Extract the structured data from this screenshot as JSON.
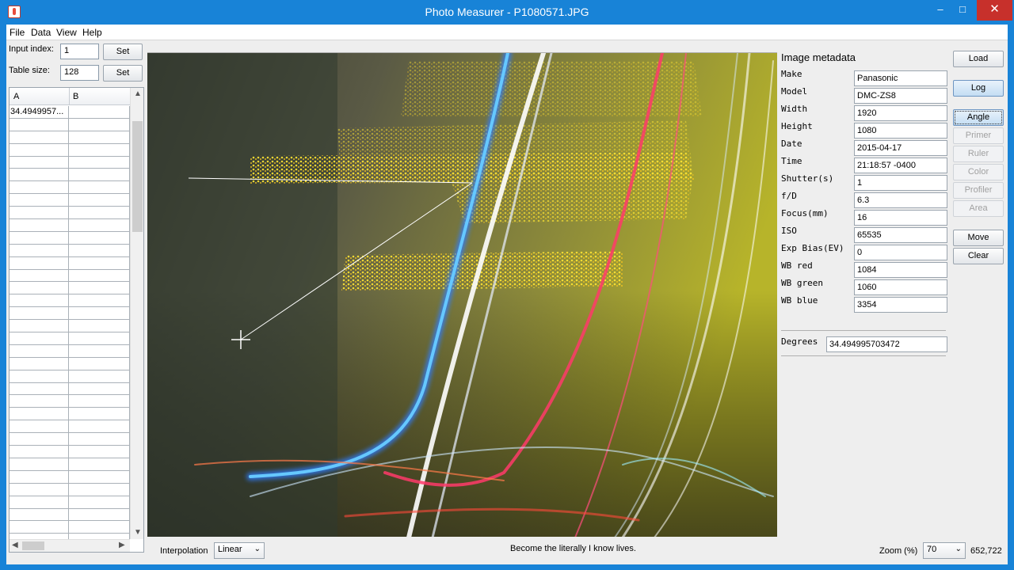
{
  "window": {
    "title": "Photo Measurer - P1080571.JPG",
    "minimize": "–",
    "maximize": "□",
    "close": "✕"
  },
  "menu": [
    "File",
    "Data",
    "View",
    "Help"
  ],
  "left": {
    "input_index_label": "Input index:",
    "input_index_value": "1",
    "table_size_label": "Table size:",
    "table_size_value": "128",
    "set_label": "Set",
    "table": {
      "columns": [
        "A",
        "B"
      ],
      "rows": [
        [
          "34.4949957...",
          ""
        ],
        [
          "",
          ""
        ],
        [
          "",
          ""
        ],
        [
          "",
          ""
        ],
        [
          "",
          ""
        ],
        [
          "",
          ""
        ],
        [
          "",
          ""
        ],
        [
          "",
          ""
        ],
        [
          "",
          ""
        ],
        [
          "",
          ""
        ],
        [
          "",
          ""
        ],
        [
          "",
          ""
        ],
        [
          "",
          ""
        ],
        [
          "",
          ""
        ],
        [
          "",
          ""
        ],
        [
          "",
          ""
        ],
        [
          "",
          ""
        ],
        [
          "",
          ""
        ],
        [
          "",
          ""
        ],
        [
          "",
          ""
        ],
        [
          "",
          ""
        ],
        [
          "",
          ""
        ],
        [
          "",
          ""
        ],
        [
          "",
          ""
        ],
        [
          "",
          ""
        ],
        [
          "",
          ""
        ],
        [
          "",
          ""
        ],
        [
          "",
          ""
        ],
        [
          "",
          ""
        ],
        [
          "",
          ""
        ],
        [
          "",
          ""
        ],
        [
          "",
          ""
        ],
        [
          "",
          ""
        ],
        [
          "",
          ""
        ],
        [
          "",
          ""
        ],
        [
          "",
          ""
        ]
      ]
    }
  },
  "metadata": {
    "title": "Image metadata",
    "fields": [
      {
        "label": "Make",
        "value": "Panasonic"
      },
      {
        "label": "Model",
        "value": "DMC-ZS8"
      },
      {
        "label": "Width",
        "value": "1920"
      },
      {
        "label": "Height",
        "value": "1080"
      },
      {
        "label": "Date",
        "value": "2015-04-17"
      },
      {
        "label": "Time",
        "value": "21:18:57 -0400"
      },
      {
        "label": "Shutter(s)",
        "value": "1"
      },
      {
        "label": "f/D",
        "value": "6.3"
      },
      {
        "label": "Focus(mm)",
        "value": "16"
      },
      {
        "label": "ISO",
        "value": "65535"
      },
      {
        "label": "Exp Bias(EV)",
        "value": "0"
      },
      {
        "label": "WB red",
        "value": "1084"
      },
      {
        "label": "WB green",
        "value": "1060"
      },
      {
        "label": "WB blue",
        "value": "3354"
      }
    ],
    "degrees_label": "Degrees",
    "degrees_value": "34.494995703472"
  },
  "tools": {
    "load": "Load",
    "log": "Log",
    "angle": "Angle",
    "primer": "Primer",
    "ruler": "Ruler",
    "color": "Color",
    "profiler": "Profiler",
    "area": "Area",
    "move": "Move",
    "clear": "Clear"
  },
  "status": {
    "interpolation_label": "Interpolation",
    "interpolation_value": "Linear",
    "message": "Become the literally I know lives.",
    "zoom_label": "Zoom (%)",
    "zoom_value": "70",
    "cursor_coords": "652,722"
  },
  "icons": {
    "app": "java-cup-icon",
    "dropdown": "chevron-down-icon",
    "crosshair": "crosshair-icon"
  },
  "colors": {
    "titlebar": "#1883d7",
    "close_button": "#c7302b",
    "active_button": "#c4ddf3"
  }
}
